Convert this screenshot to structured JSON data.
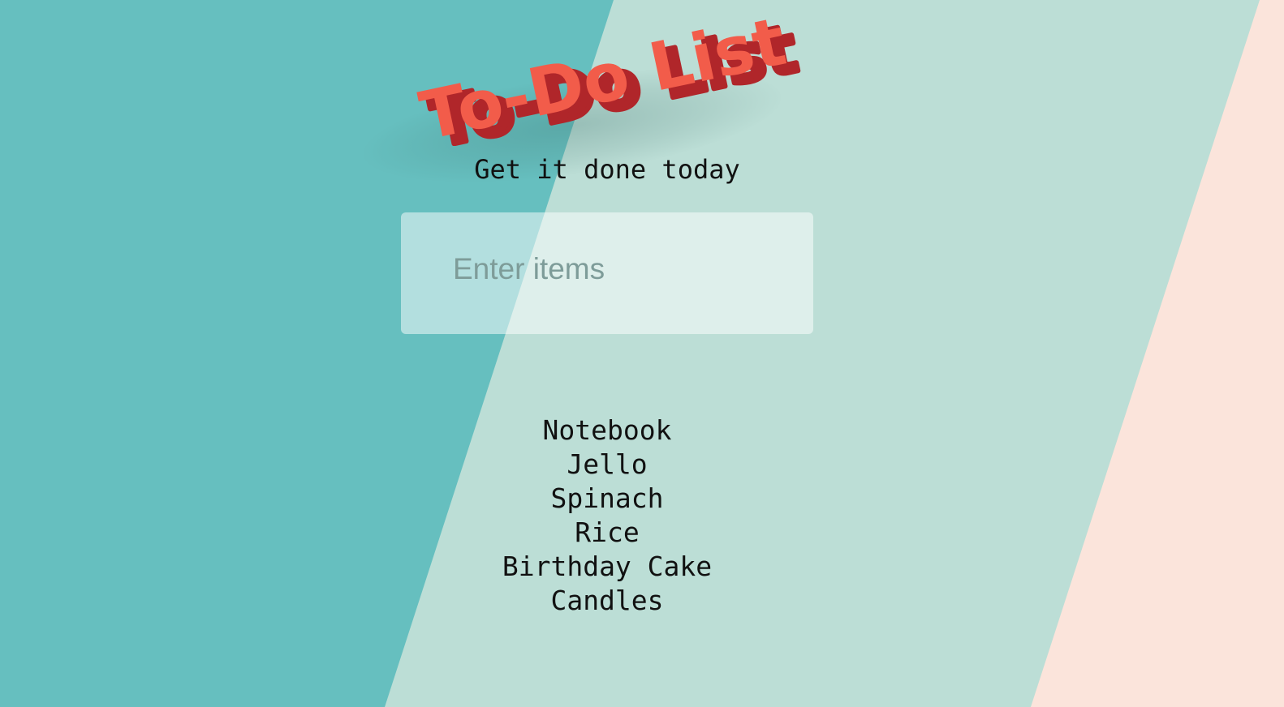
{
  "app": {
    "title": "To-Do List",
    "subtitle": "Get it done today"
  },
  "input": {
    "placeholder": "Enter items",
    "value": ""
  },
  "items": [
    "Notebook",
    "Jello",
    "Spinach",
    "Rice",
    "Birthday Cake",
    "Candles"
  ],
  "colors": {
    "teal": "#66bfbf",
    "mint": "#bcded6",
    "peach": "#fbe4db",
    "title_face": "#f25c4a",
    "title_side": "#b0262a",
    "input_bg": "#ffffff80",
    "text": "#111111"
  }
}
